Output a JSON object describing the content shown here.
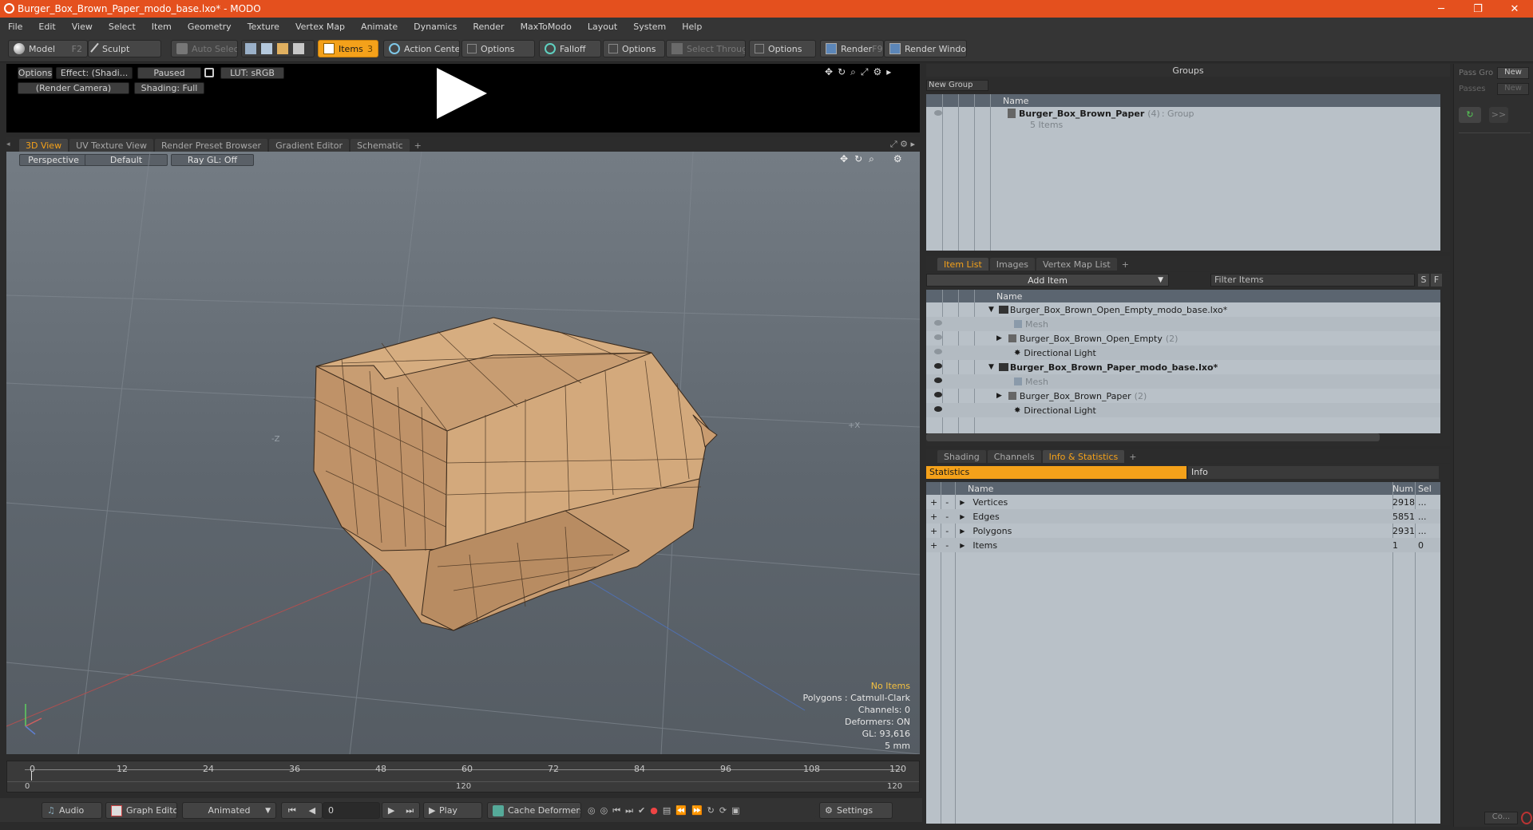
{
  "titlebar": {
    "title": "Burger_Box_Brown_Paper_modo_base.lxo* - MODO",
    "minimize": "─",
    "maximize": "❐",
    "close": "✕"
  },
  "menu": [
    "File",
    "Edit",
    "View",
    "Select",
    "Item",
    "Geometry",
    "Texture",
    "Vertex Map",
    "Animate",
    "Dynamics",
    "Render",
    "MaxToModo",
    "Layout",
    "System",
    "Help"
  ],
  "toolbar": {
    "model": "Model",
    "model_key": "F2",
    "sculpt": "Sculpt",
    "auto_select": "Auto Select",
    "items": "Items",
    "items_key": "3",
    "action_center": "Action Center",
    "options1": "Options",
    "falloff": "Falloff",
    "options2": "Options",
    "select_through": "Select Through",
    "options3": "Options",
    "render": "Render",
    "render_key": "F9",
    "render_window": "Render Window"
  },
  "preview": {
    "options": "Options",
    "effect": "Effect: (Shadi...",
    "paused": "Paused",
    "lut": "LUT: sRGB",
    "camera": "(Render Camera)",
    "shading": "Shading: Full"
  },
  "viewport_tabs": [
    "3D View",
    "UV Texture View",
    "Render Preset Browser",
    "Gradient Editor",
    "Schematic",
    "+"
  ],
  "viewport": {
    "perspective": "Perspective",
    "default": "Default",
    "raygl": "Ray GL: Off",
    "axis_z": "-Z",
    "axis_x": "+X",
    "no_items": "No Items",
    "polygons": "Polygons : Catmull-Clark",
    "channels": "Channels: 0",
    "deformers": "Deformers: ON",
    "gl": "GL: 93,616",
    "unit": "5 mm"
  },
  "timeline": {
    "ticks": [
      "0",
      "12",
      "24",
      "36",
      "48",
      "60",
      "72",
      "84",
      "96",
      "108",
      "120"
    ],
    "start": "0",
    "mid": "120",
    "end": "120"
  },
  "bottom": {
    "audio": "Audio",
    "graph_editor": "Graph Editor",
    "animated": "Animated",
    "frame": "0",
    "play": "Play",
    "cache_deformers": "Cache Deformers",
    "settings": "Settings"
  },
  "groups": {
    "title": "Groups",
    "new_group": "New Group",
    "col_name": "Name",
    "group_name": "Burger_Box_Brown_Paper",
    "group_count": "(4)",
    "group_type": ": Group",
    "group_items": "5 Items"
  },
  "items_tabs": [
    "Item List",
    "Images",
    "Vertex Map List",
    "+"
  ],
  "item_list": {
    "add_item": "Add Item",
    "filter": "Filter Items",
    "s": "S",
    "f": "F",
    "col_name": "Name",
    "rows": [
      {
        "label": "Burger_Box_Brown_Open_Empty_modo_base.lxo*",
        "count": "",
        "type": "scene",
        "dim": false
      },
      {
        "label": "Mesh",
        "count": "",
        "type": "mesh",
        "dim": true
      },
      {
        "label": "Burger_Box_Brown_Open_Empty",
        "count": "(2)",
        "type": "group",
        "dim": false
      },
      {
        "label": "Directional Light",
        "count": "",
        "type": "light",
        "dim": false
      },
      {
        "label": "Burger_Box_Brown_Paper_modo_base.lxo*",
        "count": "",
        "type": "scene",
        "dim": false
      },
      {
        "label": "Mesh",
        "count": "",
        "type": "mesh",
        "dim": true
      },
      {
        "label": "Burger_Box_Brown_Paper",
        "count": "(2)",
        "type": "group",
        "dim": false
      },
      {
        "label": "Directional Light",
        "count": "",
        "type": "light",
        "dim": false
      }
    ]
  },
  "info_tabs": [
    "Shading",
    "Channels",
    "Info & Statistics",
    "+"
  ],
  "stats": {
    "statistics": "Statistics",
    "info": "Info",
    "col_name": "Name",
    "col_num": "Num",
    "col_sel": "Sel",
    "rows": [
      {
        "name": "Vertices",
        "num": "2918",
        "sel": "..."
      },
      {
        "name": "Edges",
        "num": "5851",
        "sel": "..."
      },
      {
        "name": "Polygons",
        "num": "2931",
        "sel": "..."
      },
      {
        "name": "Items",
        "num": "1",
        "sel": "0"
      }
    ]
  },
  "right_strip": {
    "pass_group": "Pass Gro",
    "new1": "New",
    "passes": "Passes",
    "new2": "New",
    "arrows": ">>",
    "co": "Co..."
  },
  "colors": {
    "accent": "#f4a11a",
    "titlebar": "#e4501e",
    "mesh": "#c89d72"
  }
}
